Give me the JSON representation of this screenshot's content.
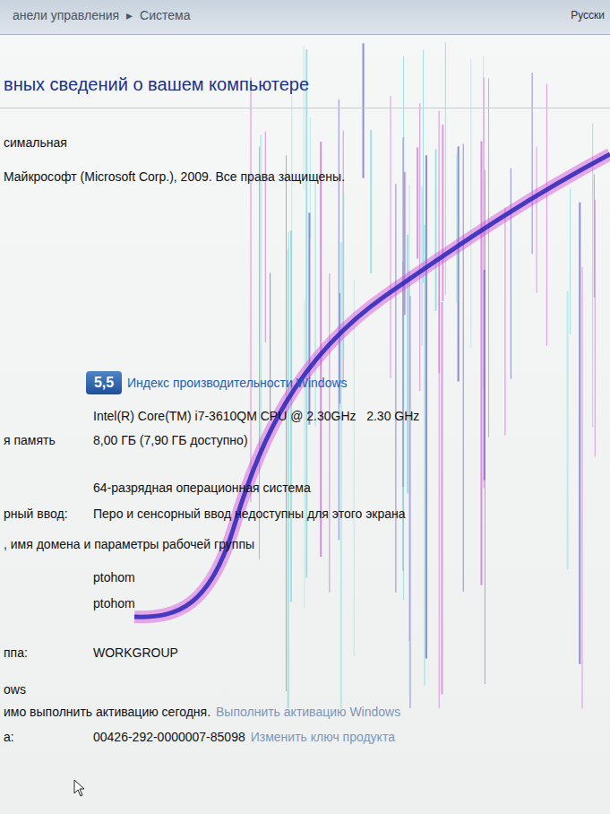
{
  "window": {
    "breadcrumb": [
      "анели управления",
      "▸",
      "Система"
    ],
    "language": "Русски"
  },
  "heading": "вных сведений о вашем компьютере",
  "edition": {
    "name": "симальная",
    "copyright": "Майкрософт (Microsoft Corp.), 2009. Все права защищены."
  },
  "rating": {
    "score": "5,5",
    "link": "Индекс производительности Windows"
  },
  "system": [
    {
      "label": "",
      "value": "Intel(R) Core(TM) i7-3610QM CPU @ 2.30GHz   2.30 GHz"
    },
    {
      "label": "я память",
      "value": "8,00 ГБ (7,90 ГБ доступно)"
    },
    {
      "label": "",
      "value": "64-разрядная операционная система"
    },
    {
      "label": "рный ввод:",
      "value": "Перо и сенсорный ввод недоступны для этого экрана"
    }
  ],
  "computer": {
    "heading": ", имя домена и параметры рабочей группы",
    "rows": [
      {
        "label": "",
        "value": "ptohom"
      },
      {
        "label": "",
        "value": "ptohom"
      },
      {
        "label": "ппа:",
        "value": "WORKGROUP"
      }
    ]
  },
  "activation": {
    "heading": "ows",
    "status": "имо выполнить активацию сегодня.",
    "link": "Выполнить активацию Windows",
    "key_label": "а:",
    "key": "00426-292-0000007-85098",
    "key_link": "Изменить ключ продукта"
  }
}
